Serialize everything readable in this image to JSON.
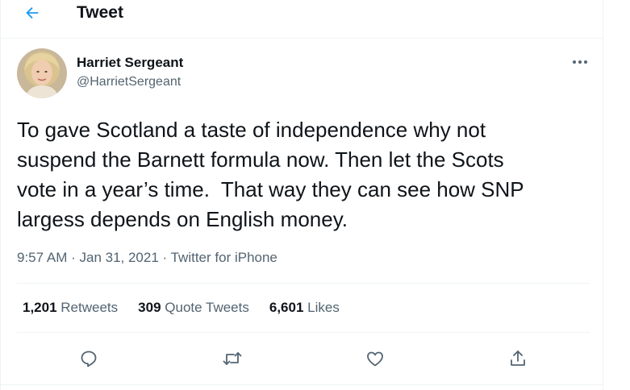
{
  "header": {
    "back_icon": "arrow-left-icon",
    "title": "Tweet"
  },
  "author": {
    "name": "Harriet Sergeant",
    "handle": "@HarrietSergeant",
    "more_icon": "more-horizontal-icon"
  },
  "tweet": {
    "text": "To gave Scotland a taste of independence why not\nsuspend the Barnett formula now. Then let the Scots\nvote in a year’s time.  That way they can see how SNP\nlargess depends on English money.",
    "time": "9:57 AM",
    "separator_1": " · ",
    "date": "Jan 31, 2021",
    "separator_2": " · ",
    "source": "Twitter for iPhone"
  },
  "stats": {
    "retweets_count": "1,201",
    "retweets_label": "Retweets",
    "quotes_count": "309",
    "quotes_label": "Quote Tweets",
    "likes_count": "6,601",
    "likes_label": "Likes"
  },
  "actions": {
    "reply_icon": "reply-icon",
    "retweet_icon": "retweet-icon",
    "like_icon": "heart-icon",
    "share_icon": "share-icon"
  },
  "colors": {
    "accent": "#1d9bf0",
    "text_primary": "#0f1419",
    "text_secondary": "#536471",
    "divider": "#eff3f4"
  }
}
